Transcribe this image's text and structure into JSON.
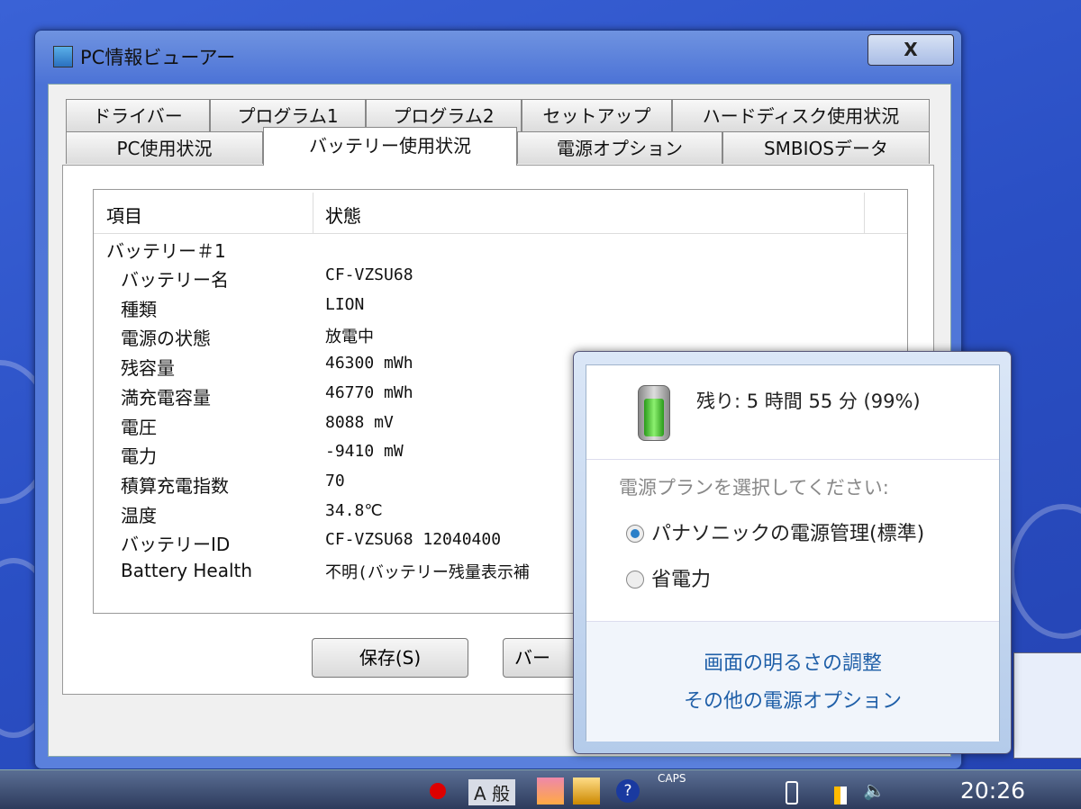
{
  "window": {
    "title": "PC情報ビューアー",
    "close": "X"
  },
  "tabs_row1": [
    "ドライバー",
    "プログラム1",
    "プログラム2",
    "セットアップ",
    "ハードディスク使用状況"
  ],
  "tabs_row2": [
    "PC使用状況",
    "バッテリー使用状況",
    "電源オプション",
    "SMBIOSデータ"
  ],
  "list": {
    "headers": [
      "項目",
      "状態"
    ],
    "group": "バッテリー＃1",
    "rows": [
      {
        "k": "バッテリー名",
        "v": "CF-VZSU68"
      },
      {
        "k": "種類",
        "v": "LION"
      },
      {
        "k": "電源の状態",
        "v": "放電中"
      },
      {
        "k": "残容量",
        "v": "46300 mWh"
      },
      {
        "k": "満充電容量",
        "v": "46770 mWh"
      },
      {
        "k": "電圧",
        "v": "8088 mV"
      },
      {
        "k": "電力",
        "v": "-9410 mW"
      },
      {
        "k": "積算充電指数",
        "v": "70"
      },
      {
        "k": "温度",
        "v": "34.8℃"
      },
      {
        "k": "バッテリーID",
        "v": "CF-VZSU68    12040400"
      },
      {
        "k": "Battery Health",
        "v": "不明(バッテリー残量表示補"
      }
    ]
  },
  "buttons": {
    "save": "保存(S)",
    "second": "バー"
  },
  "popup": {
    "remaining": "残り: 5 時間 55 分 (99%)",
    "plan_prompt": "電源プランを選択してください:",
    "plans": [
      {
        "label": "パナソニックの電源管理(標準)",
        "selected": true
      },
      {
        "label": "省電力",
        "selected": false
      }
    ],
    "links": [
      "画面の明るさの調整",
      "その他の電源オプション"
    ]
  },
  "taskbar": {
    "caps": "CAPS",
    "clock": "20:26",
    "ime": "A 般"
  }
}
